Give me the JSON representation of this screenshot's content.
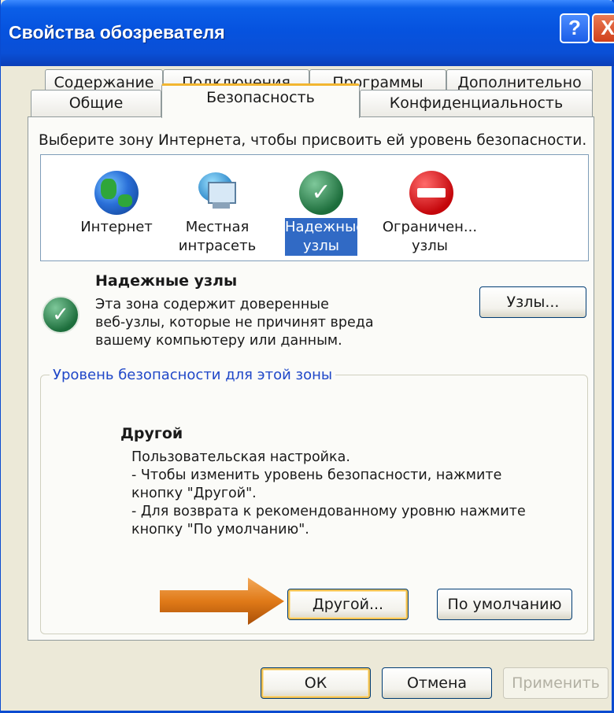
{
  "window": {
    "title": "Свойства обозревателя",
    "help_glyph": "?",
    "close_glyph": "X"
  },
  "tabs": {
    "row_back": [
      "Содержание",
      "Подключения",
      "Программы",
      "Дополнительно"
    ],
    "row_front": [
      "Общие",
      "Безопасность",
      "Конфиденциальность"
    ],
    "active": "Безопасность"
  },
  "security": {
    "prompt": "Выберите зону Интернета, чтобы присвоить ей уровень безопасности.",
    "zones": [
      {
        "line1": "Интернет",
        "line2": "",
        "icon": "globe-icon"
      },
      {
        "line1": "Местная",
        "line2": "интрасеть",
        "icon": "computer-network-icon"
      },
      {
        "line1": "Надежные",
        "line2": "узлы",
        "icon": "trusted-check-icon",
        "selected": true
      },
      {
        "line1": "Ограничен...",
        "line2": "узлы",
        "icon": "restricted-icon"
      }
    ],
    "selected_zone": {
      "title": "Надежные узлы",
      "desc_lines": [
        "Эта зона содержит доверенные",
        "веб-узлы, которые не причинят вреда",
        "вашему компьютеру или данным."
      ],
      "sites_button": "Узлы..."
    },
    "level_group": {
      "label": "Уровень безопасности для этой зоны",
      "level_name": "Другой",
      "level_desc_lines": [
        "Пользовательская настройка.",
        "- Чтобы изменить уровень безопасности, нажмите",
        "кнопку \"Другой\".",
        "- Для возврата к рекомендованному уровню нажмите",
        "кнопку \"По умолчанию\"."
      ],
      "custom_button": "Другой...",
      "default_button": "По умолчанию"
    }
  },
  "footer": {
    "ok": "ОК",
    "cancel": "Отмена",
    "apply": "Применить"
  },
  "colors": {
    "titlebar": "#0653df",
    "selection": "#316ac5",
    "arrow": "#e07a18"
  }
}
